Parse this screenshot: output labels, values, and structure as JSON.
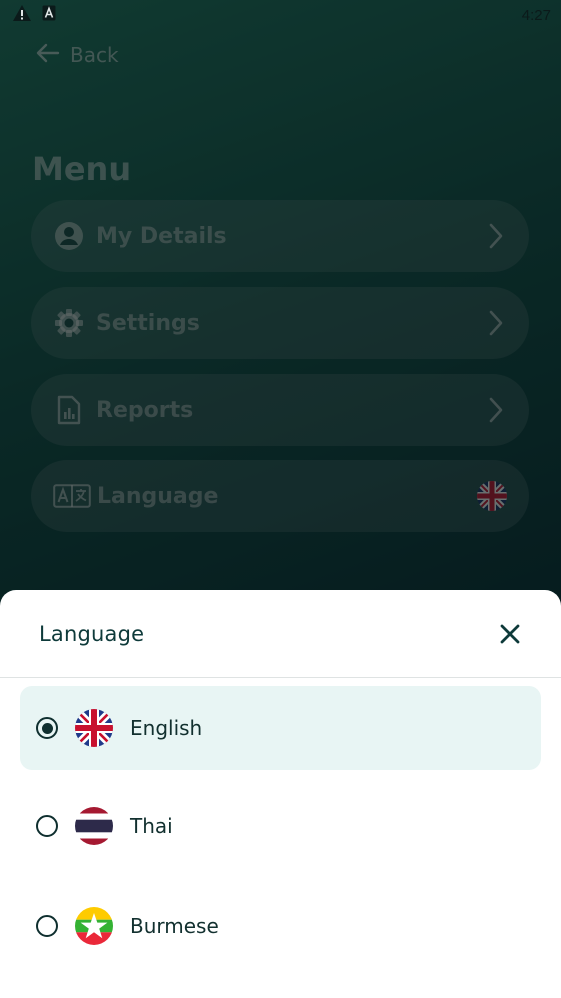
{
  "status_bar": {
    "time": "4:27",
    "icons": [
      "warning-icon",
      "notification-a-icon"
    ]
  },
  "nav": {
    "back_label": "Back"
  },
  "menu": {
    "title": "Menu",
    "items": [
      {
        "label": "My Details",
        "icon": "user-icon"
      },
      {
        "label": "Settings",
        "icon": "gear-icon"
      },
      {
        "label": "Reports",
        "icon": "report-icon"
      },
      {
        "label": "Language",
        "icon": "translate-icon",
        "current_flag": "uk-flag-icon"
      }
    ]
  },
  "sheet": {
    "title": "Language",
    "options": [
      {
        "label": "English",
        "flag": "uk-flag-icon",
        "selected": true
      },
      {
        "label": "Thai",
        "flag": "thai-flag-icon",
        "selected": false
      },
      {
        "label": "Burmese",
        "flag": "myanmar-flag-icon",
        "selected": false
      }
    ]
  },
  "colors": {
    "accent_dark": "#0e3a3a",
    "selected_bg": "#e8f5f4",
    "background_gradient_top": "#1f6a5a",
    "background_gradient_bottom": "#0a2c33"
  }
}
